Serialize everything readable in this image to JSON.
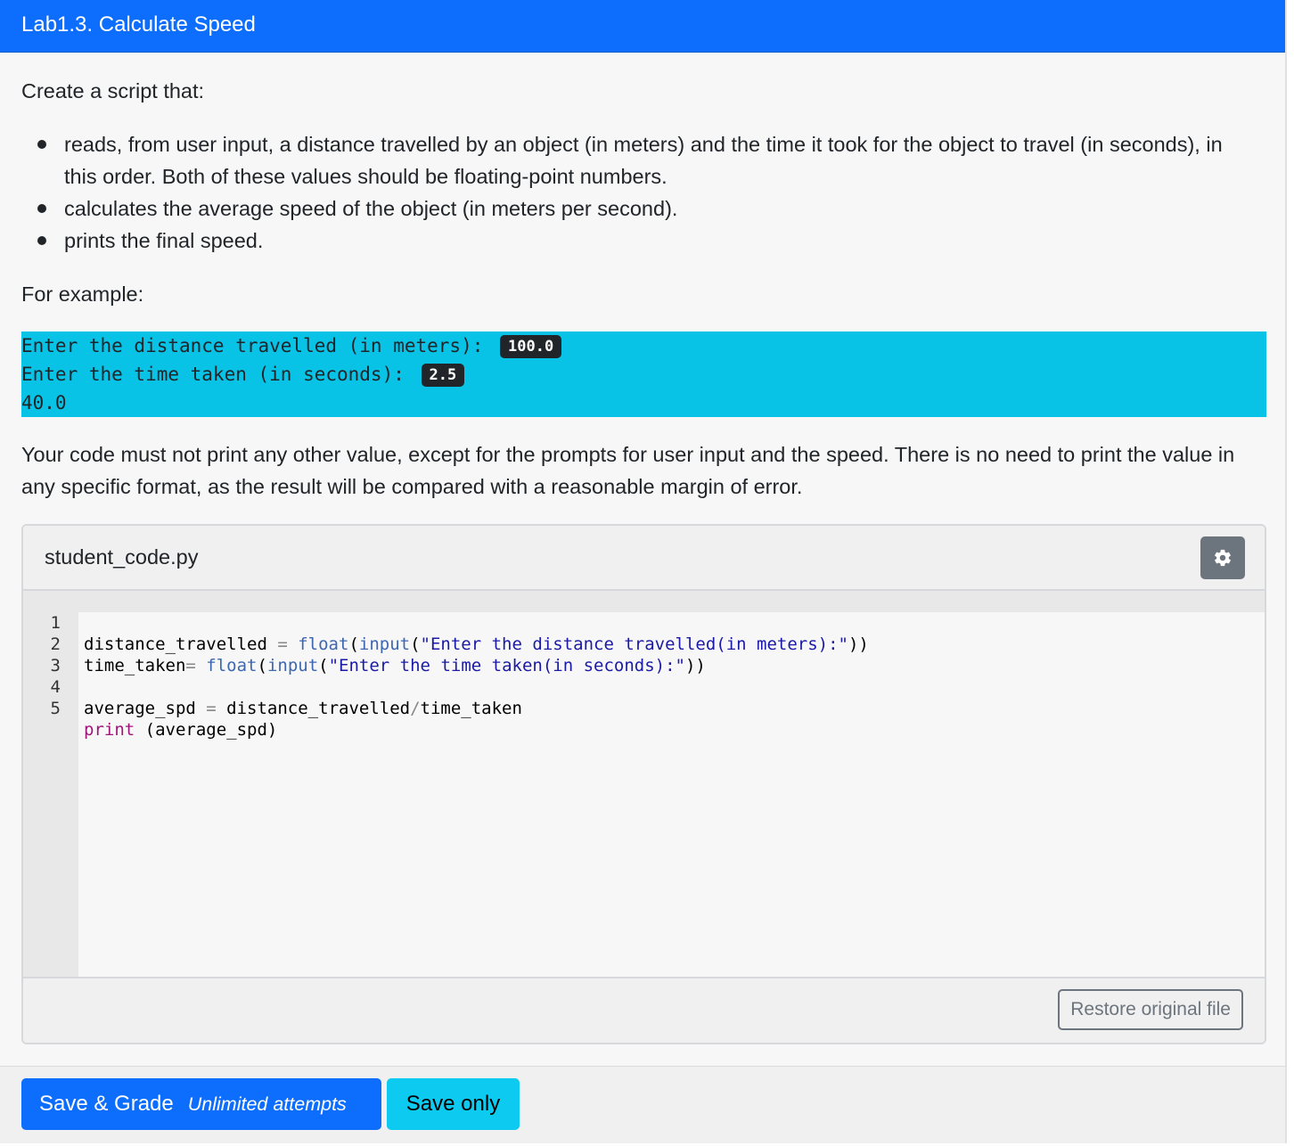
{
  "header": {
    "title": "Lab1.3. Calculate Speed"
  },
  "instructions": {
    "intro": "Create a script that:",
    "bullets": [
      "reads, from user input, a distance travelled by an object (in meters) and the time it took for the object to travel (in seconds), in this order. Both of these values should be floating-point numbers.",
      "calculates the average speed of the object (in meters per second).",
      "prints the final speed."
    ],
    "example_label": "For example:",
    "note": "Your code must not print any other value, except for the prompts for user input and the speed. There is no need to print the value in any specific format, as the result will be compared with a reasonable margin of error."
  },
  "example": {
    "lines": [
      {
        "prompt": "Enter the distance travelled (in meters): ",
        "input": "100.0"
      },
      {
        "prompt": "Enter the time taken (in seconds): ",
        "input": "2.5"
      },
      {
        "output": "40.0"
      }
    ]
  },
  "editor": {
    "filename": "student_code.py",
    "settings_icon": "gear-icon",
    "line_numbers": [
      "1",
      "2",
      "3",
      "4",
      "5"
    ],
    "code": [
      "distance_travelled = float(input(\"Enter the distance travelled(in meters):\"))",
      "time_taken= float(input(\"Enter the time taken(in seconds):\"))",
      "",
      "average_spd = distance_travelled/time_taken",
      "print (average_spd)"
    ],
    "active_line": 1,
    "restore_label": "Restore original file"
  },
  "footer": {
    "save_grade_label": "Save & Grade",
    "attempts_label": "Unlimited attempts",
    "save_only_label": "Save only"
  },
  "colors": {
    "primary": "#0d6efd",
    "info": "#0dcaf0",
    "terminal_bg": "#08c3e6",
    "secondary": "#6c757d"
  }
}
